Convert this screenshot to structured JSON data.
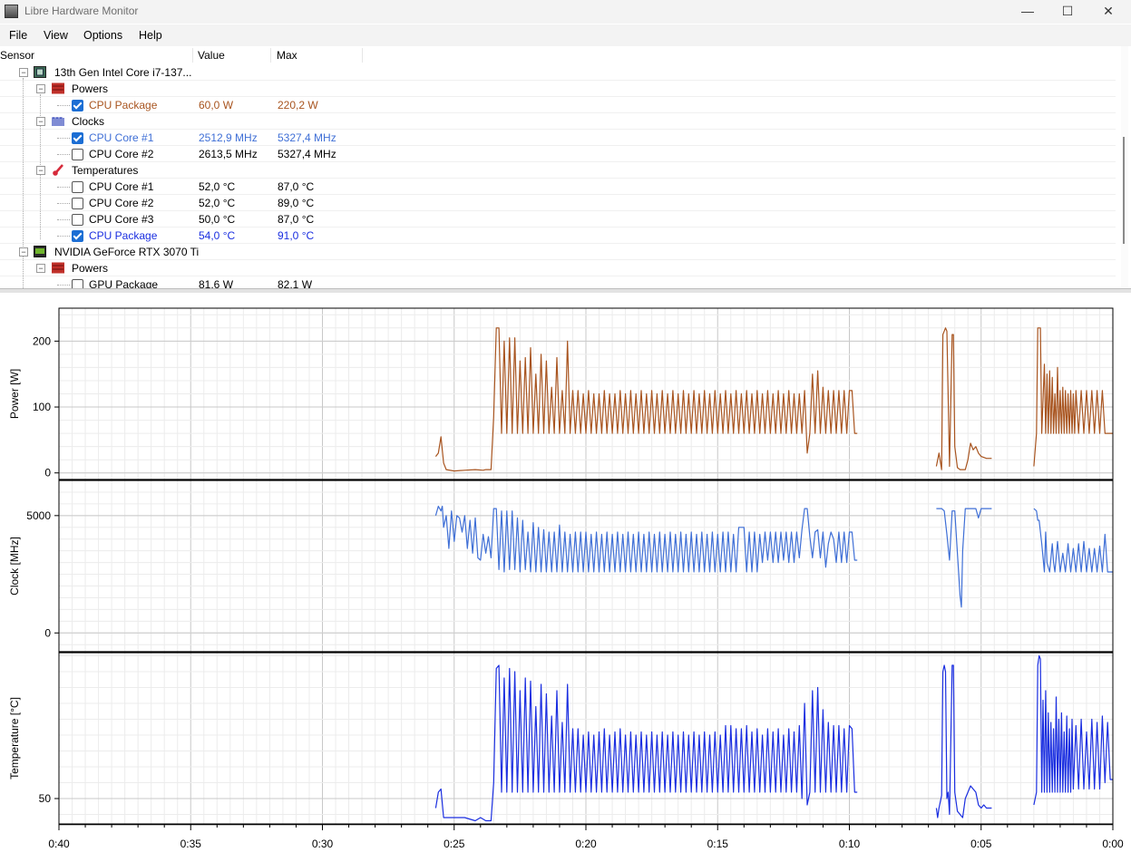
{
  "window": {
    "title": "Libre Hardware Monitor"
  },
  "menu": [
    "File",
    "View",
    "Options",
    "Help"
  ],
  "columns": {
    "sensor": "Sensor",
    "value": "Value",
    "max": "Max"
  },
  "rows": [
    {
      "label": "13th Gen Intel Core i7-137...",
      "level": 1,
      "icon": "cpu-chip-icon",
      "value": "",
      "max": ""
    },
    {
      "label": "Powers",
      "level": 2,
      "icon": "power-bars-icon",
      "value": "",
      "max": ""
    },
    {
      "label": "CPU Package",
      "level": 3,
      "checked": true,
      "color": "#a8541f",
      "value": "60,0 W",
      "max": "220,2 W"
    },
    {
      "label": "Clocks",
      "level": 2,
      "icon": "clock-wave-icon",
      "value": "",
      "max": ""
    },
    {
      "label": "CPU Core #1",
      "level": 3,
      "checked": true,
      "color": "#3f6fd6",
      "value": "2512,9 MHz",
      "max": "5327,4 MHz"
    },
    {
      "label": "CPU Core #2",
      "level": 3,
      "checked": false,
      "color": "",
      "value": "2613,5 MHz",
      "max": "5327,4 MHz"
    },
    {
      "label": "Temperatures",
      "level": 2,
      "icon": "thermometer-icon",
      "value": "",
      "max": ""
    },
    {
      "label": "CPU Core #1",
      "level": 3,
      "checked": false,
      "color": "",
      "value": "52,0 °C",
      "max": "87,0 °C"
    },
    {
      "label": "CPU Core #2",
      "level": 3,
      "checked": false,
      "color": "",
      "value": "52,0 °C",
      "max": "89,0 °C"
    },
    {
      "label": "CPU Core #3",
      "level": 3,
      "checked": false,
      "color": "",
      "value": "50,0 °C",
      "max": "87,0 °C"
    },
    {
      "label": "CPU Package",
      "level": 3,
      "checked": true,
      "color": "#1a2ee0",
      "value": "54,0 °C",
      "max": "91,0 °C"
    },
    {
      "label": "NVIDIA GeForce RTX 3070 Ti",
      "level": 1,
      "icon": "gpu-card-icon",
      "value": "",
      "max": ""
    },
    {
      "label": "Powers",
      "level": 2,
      "icon": "power-bars-icon",
      "value": "",
      "max": ""
    },
    {
      "label": "GPU Package",
      "level": 3,
      "checked": false,
      "color": "",
      "value": "81,6 W",
      "max": "82,1 W"
    }
  ],
  "chart_data": [
    {
      "type": "line",
      "xlabel": "",
      "ylabel": "Power [W]",
      "ylim": [
        -10,
        250
      ],
      "yticks": [
        0,
        100,
        200
      ],
      "xlim": [
        40,
        0
      ],
      "series": [
        {
          "color": "#a8541f",
          "x": [],
          "y": []
        }
      ]
    },
    {
      "type": "line",
      "xlabel": "",
      "ylabel": "Clock [MHz]",
      "ylim": [
        -800,
        6500
      ],
      "yticks": [
        0,
        5000
      ],
      "xlim": [
        40,
        0
      ],
      "series": [
        {
          "color": "#3f6fd6",
          "x": [],
          "y": []
        }
      ]
    },
    {
      "type": "line",
      "ylabel": "Temperature [°C]",
      "ylim": [
        42,
        96
      ],
      "yticks": [
        50
      ],
      "xlim": [
        40,
        0
      ],
      "xticks": [
        "0:40",
        "0:35",
        "0:30",
        "0:25",
        "0:20",
        "0:15",
        "0:10",
        "0:05",
        "0:00"
      ],
      "series": [
        {
          "color": "#1a2ee0",
          "x": [],
          "y": []
        }
      ]
    }
  ]
}
